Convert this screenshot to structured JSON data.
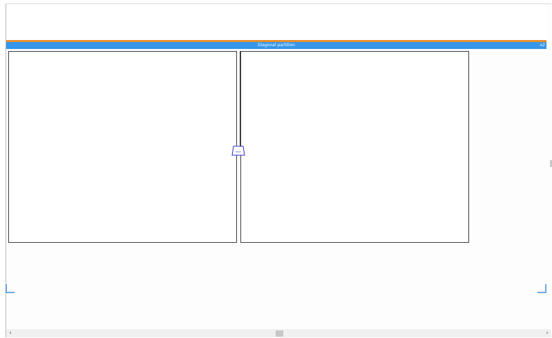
{
  "header": {
    "title": "Diagonal partition",
    "zoom_indicator": "x2"
  },
  "diagram": {
    "node_label": "Stem"
  },
  "scrollbar": {
    "left_arrow": "‹",
    "right_arrow": "›"
  },
  "colors": {
    "accent_blue": "#3596ea",
    "orange": "#e8902e",
    "node_blue": "#2b2bd6",
    "corner_blue": "#3a8fd8"
  }
}
